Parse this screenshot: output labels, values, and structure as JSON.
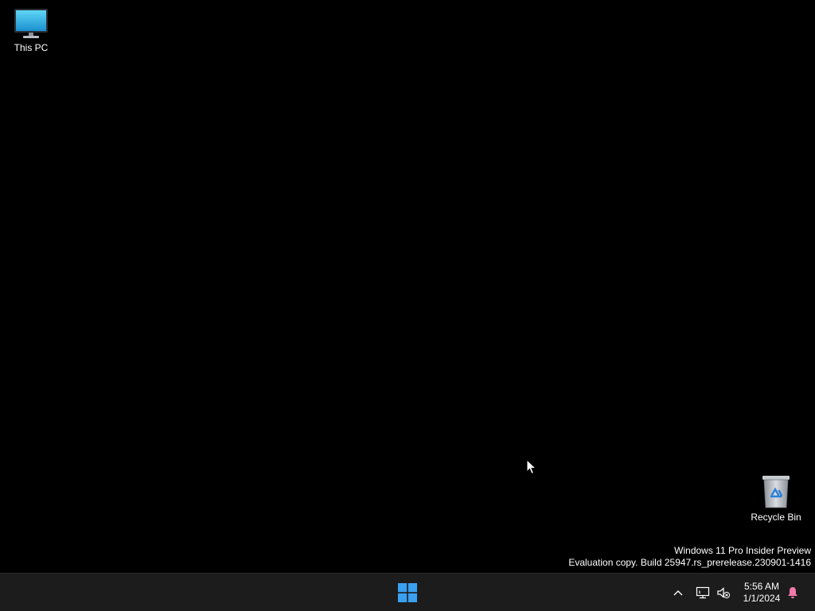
{
  "desktop": {
    "icons": [
      {
        "label": "This PC",
        "icon": "monitor-icon"
      },
      {
        "label": "Recycle Bin",
        "icon": "recycle-bin-icon"
      }
    ],
    "watermark": {
      "line1": "Windows 11 Pro Insider Preview",
      "line2": "Evaluation copy. Build 25947.rs_prerelease.230901-1416"
    }
  },
  "taskbar": {
    "start_icon": "windows-logo-icon",
    "tray": {
      "chevron_icon": "chevron-up-icon",
      "network_icon": "network-icon",
      "volume_icon": "volume-muted-icon",
      "time": "5:56 AM",
      "date": "1/1/2024",
      "notification_icon": "bell-icon"
    }
  },
  "colors": {
    "desktop_background": "#000000",
    "taskbar_background": "#1c1c1c",
    "windows_logo": "#3aa0f0",
    "notification_accent": "#f07aa8"
  }
}
